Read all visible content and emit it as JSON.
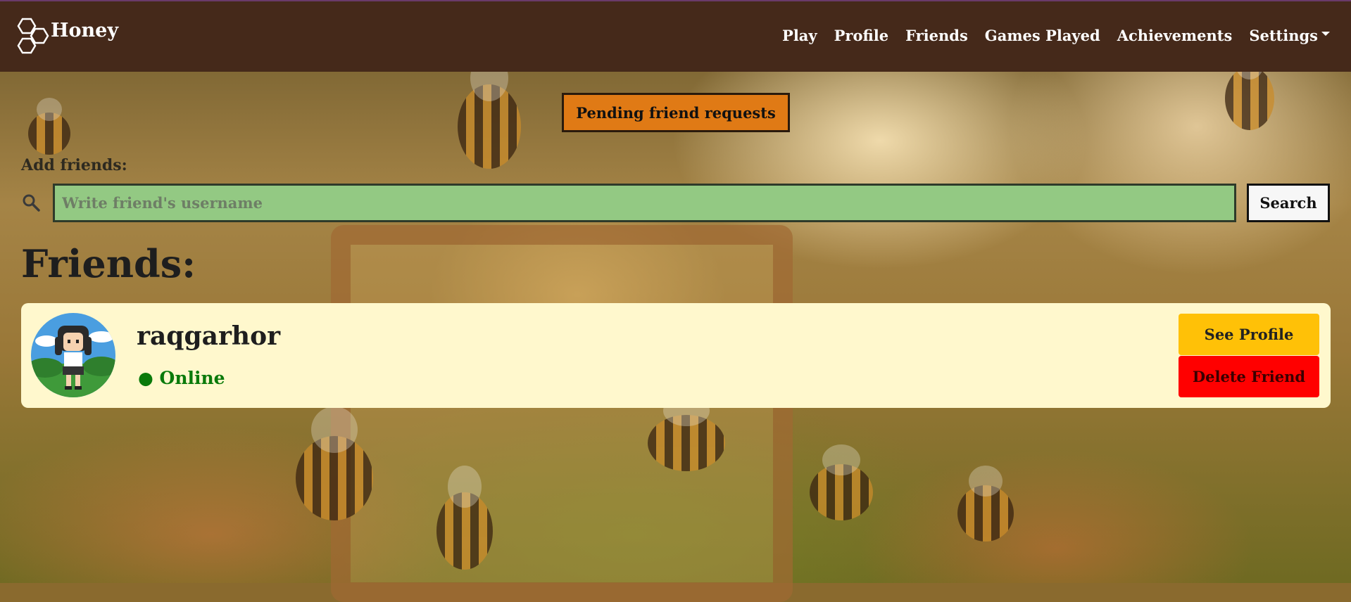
{
  "brand": {
    "name": "Honey",
    "logo_icon": "honeycomb-icon"
  },
  "nav": {
    "items": [
      {
        "label": "Play"
      },
      {
        "label": "Profile"
      },
      {
        "label": "Friends"
      },
      {
        "label": "Games Played"
      },
      {
        "label": "Achievements"
      },
      {
        "label": "Settings",
        "has_dropdown": true
      }
    ]
  },
  "pending": {
    "label": "Pending friend requests"
  },
  "add_friends": {
    "label": "Add friends:",
    "search_icon": "search-icon",
    "placeholder": "Write friend's username",
    "value": "",
    "button_label": "Search"
  },
  "friends": {
    "title": "Friends:",
    "list": [
      {
        "username": "raqgarhor",
        "status_dot": "●",
        "status": "Online",
        "see_profile_label": "See Profile",
        "delete_label": "Delete Friend"
      }
    ]
  },
  "colors": {
    "navbar": "#45291a",
    "pending_button": "#e07a15",
    "search_input": "#93c983",
    "card": "#fff8cd",
    "see_profile": "#ffc107",
    "delete": "#ff0000",
    "online": "#0a7a0a"
  }
}
